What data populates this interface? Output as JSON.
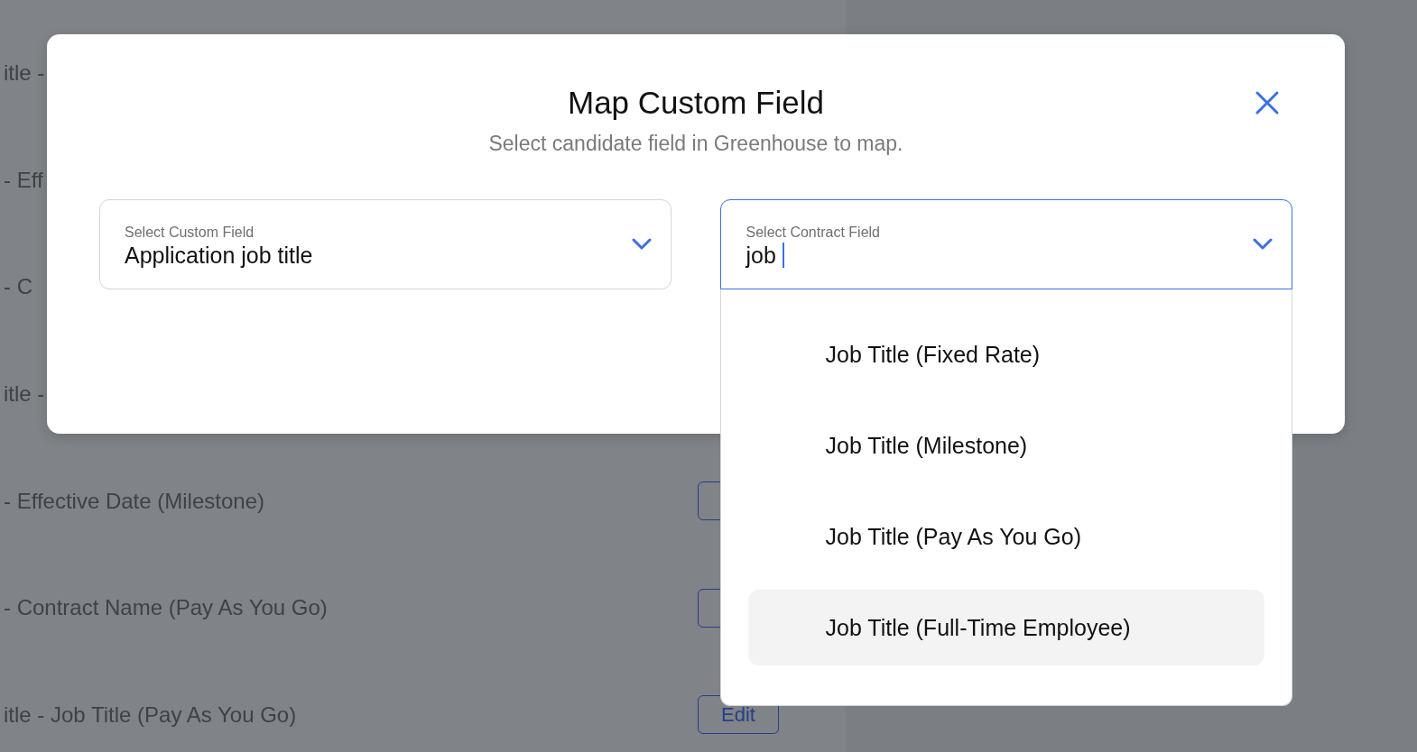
{
  "background_rows": [
    {
      "text": "itle -"
    },
    {
      "text": "- Eff"
    },
    {
      "text": "- C"
    },
    {
      "text": "itle -"
    },
    {
      "text": "- Effective Date (Milestone)",
      "button": true
    },
    {
      "text": "- Contract Name (Pay As You Go)",
      "button": true
    },
    {
      "text": "itle - Job Title (Pay As You Go)",
      "button": true,
      "button_label": "Edit"
    }
  ],
  "modal": {
    "title": "Map Custom Field",
    "subtitle": "Select candidate field in Greenhouse to map.",
    "fields": [
      {
        "label": "Select Custom Field",
        "value": "Application job title",
        "focused": false
      },
      {
        "label": "Select Contract Field",
        "value": "job",
        "focused": true
      }
    ],
    "dropdown": {
      "options": [
        {
          "label": "Job Title (Fixed Rate)",
          "highlighted": false
        },
        {
          "label": "Job Title (Milestone)",
          "highlighted": false
        },
        {
          "label": "Job Title (Pay As You Go)",
          "highlighted": false
        },
        {
          "label": "Job Title (Full-Time Employee)",
          "highlighted": true
        }
      ]
    }
  }
}
